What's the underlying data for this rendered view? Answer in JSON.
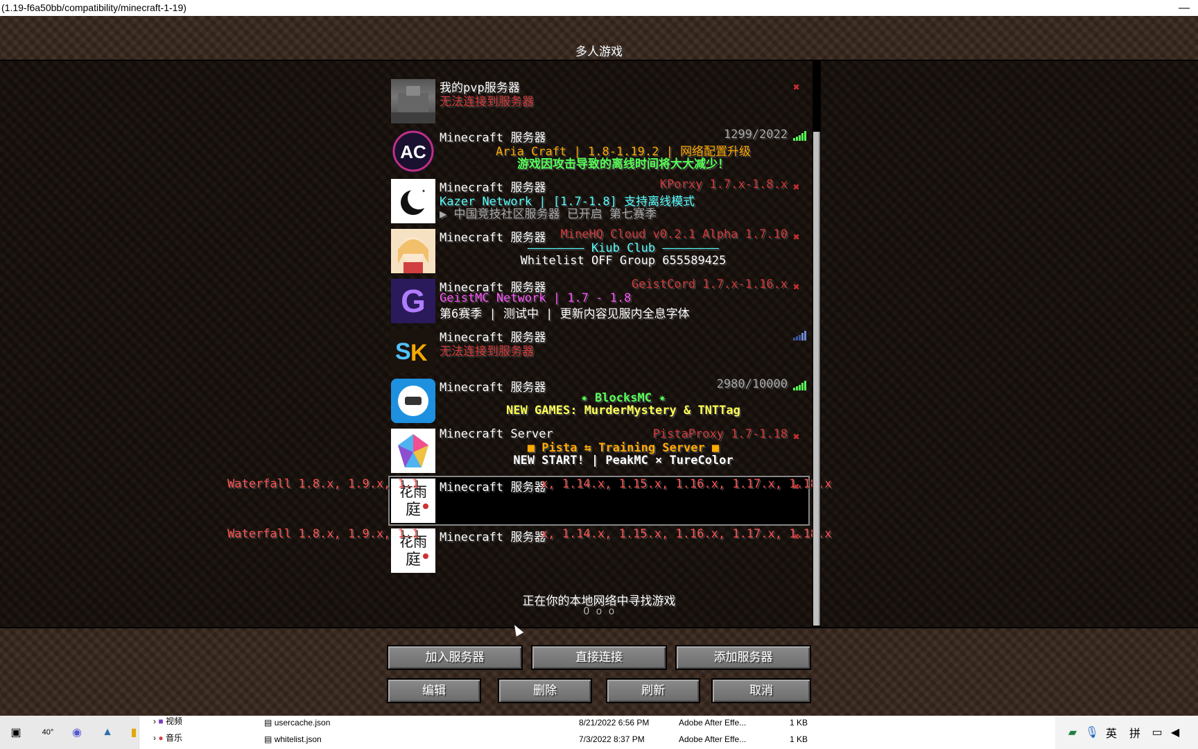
{
  "window": {
    "title": "(1.19-f6a50bb/compatibility/minecraft-1-19)",
    "minimize": "—"
  },
  "screen": {
    "title": "多人游戏"
  },
  "servers": [
    {
      "name": "我的pvp服务器",
      "status": "",
      "motd1": "无法连接到服务器",
      "motd2": "",
      "icon": "stone-icon"
    },
    {
      "name": "Minecraft 服务器",
      "status": "1299/2022",
      "motd1": "Aria Craft | 1.8-1.19.2 | 网络配置升级",
      "motd2": "游戏因攻击导致的离线时间将大大减少！",
      "icon": "ac-logo-icon"
    },
    {
      "name": "Minecraft 服务器",
      "status": "KPorxy 1.7.x-1.8.x",
      "motd1": "Kazer Network | [1.7-1.8] 支持离线模式",
      "motd2": "▶ 中国竞技社区服务器 已开启 第七赛季",
      "icon": "moon-icon"
    },
    {
      "name": "Minecraft 服务器",
      "status": "MineHQ Cloud v0.2.1 Alpha 1.7.10",
      "motd1": "———————— Kiub Club ————————",
      "motd2": "Whitelist OFF   Group 655589425",
      "icon": "anime-girl-icon"
    },
    {
      "name": "Minecraft 服务器",
      "status": "GeistCord 1.7.x-1.16.x",
      "motd1": "GeistMC Network | 1.7 - 1.8",
      "motd2": "第6赛季 | 测试中 | 更新内容见服内全息字体",
      "icon": "g-logo-icon"
    },
    {
      "name": "Minecraft 服务器",
      "status": "",
      "motd1": "无法连接到服务器",
      "motd2": "",
      "icon": "sk-logo-icon"
    },
    {
      "name": "Minecraft 服务器",
      "status": "2980/10000",
      "motd1": "✷ BlocksMC ✷",
      "motd2": "NEW GAMES: MurderMystery & TNTTag",
      "icon": "blocksmc-icon"
    },
    {
      "name": "Minecraft Server",
      "status": "PistaProxy 1.7-1.18",
      "motd1": "■ Pista ⇆ Training Server ■",
      "motd2": "NEW START! | PeakMC × TureColor",
      "icon": "pista-icon"
    },
    {
      "name": "Minecraft 服务器",
      "status": "Waterfall 1.8.x, 1.9.x, 1.1... 1.14.x, 1.15.x, 1.16.x, 1.17.x, 1.18.x",
      "motd1": "",
      "motd2": "",
      "icon": "calligraphy-icon"
    },
    {
      "name": "Minecraft 服务器",
      "status": "Waterfall 1.8.x, 1.9.x, 1.1... 1.14.x, 1.15.x, 1.16.x, 1.17.x, 1.18.x",
      "motd1": "",
      "motd2": "",
      "icon": "calligraphy-icon"
    }
  ],
  "overflow_status_a": "Waterfall 1.8.x, 1.9.x, 1.1",
  "overflow_status_b": "x, 1.14.x, 1.15.x, 1.16.x, 1.17.x, 1.18.x",
  "lan": {
    "text": "正在你的本地网络中寻找游戏",
    "dots": "O o o"
  },
  "buttons": {
    "join": "加入服务器",
    "direct": "直接连接",
    "add": "添加服务器",
    "edit": "编辑",
    "delete": "删除",
    "refresh": "刷新",
    "cancel": "取消"
  },
  "taskbar": {
    "temp": "40°",
    "folder1": "视频",
    "folder2": "音乐",
    "files": [
      {
        "name": "usercache.json",
        "date": "8/21/2022 6:56 PM",
        "type": "Adobe After Effe...",
        "size": "1 KB"
      },
      {
        "name": "whitelist.json",
        "date": "7/3/2022 8:37 PM",
        "type": "Adobe After Effe...",
        "size": "1 KB"
      }
    ],
    "ime1": "英",
    "ime2": "拼"
  },
  "colors": {
    "accent_green": "#55ff55",
    "error_red": "#d13a3a"
  }
}
